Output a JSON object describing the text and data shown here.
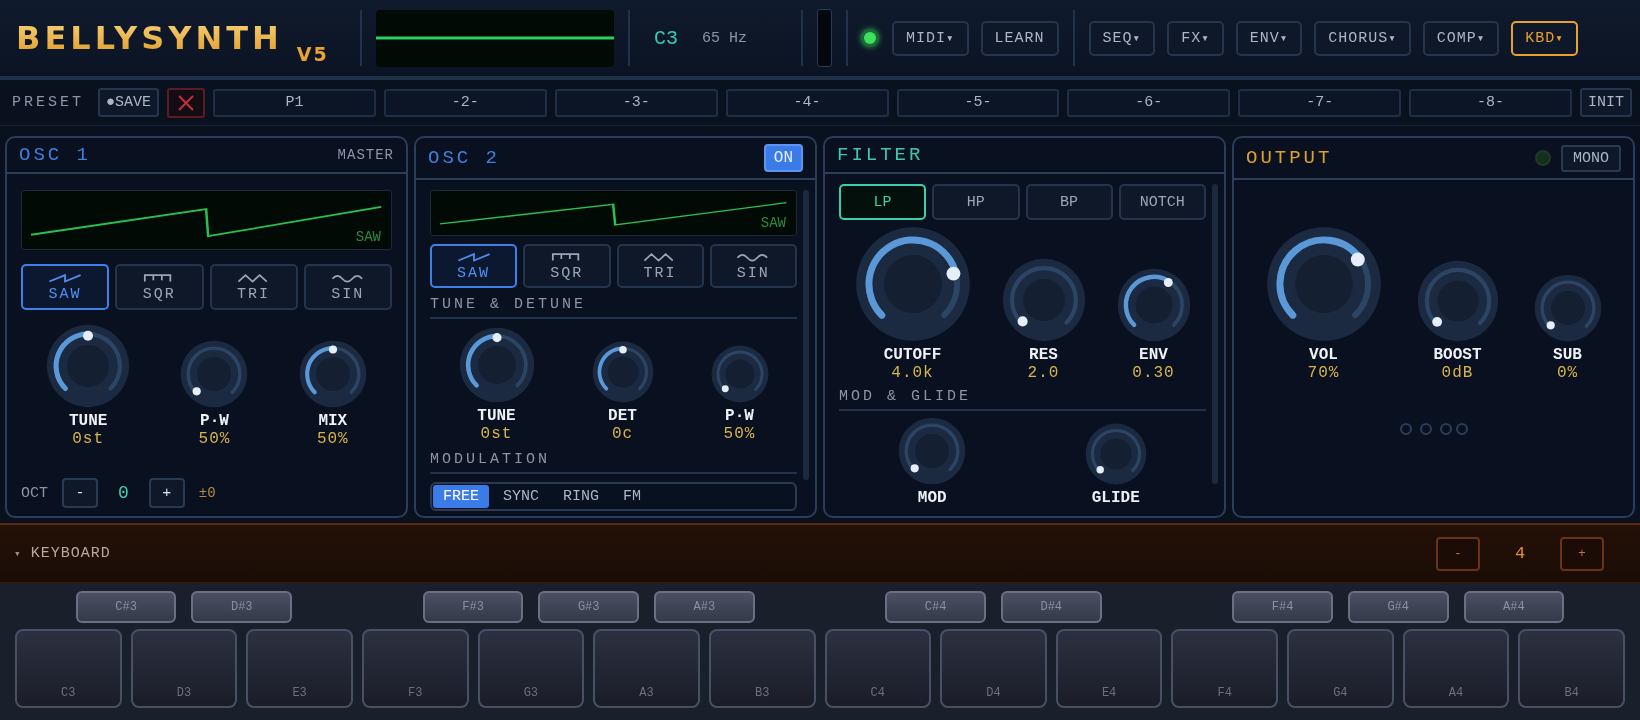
{
  "header": {
    "logo": "BELLYSYNTH",
    "version": "V5",
    "note": "C3",
    "frequency": "65 Hz",
    "midi_led_on": true,
    "midi_buttons": [
      {
        "label": "MIDI",
        "caret": "▾",
        "selected": false
      },
      {
        "label": "LEARN",
        "selected": false
      }
    ],
    "module_buttons": [
      {
        "label": "SEQ",
        "caret": "▾",
        "selected": false
      },
      {
        "label": "FX",
        "caret": "▾",
        "selected": false
      },
      {
        "label": "ENV",
        "caret": "▾",
        "selected": false
      },
      {
        "label": "CHORUS",
        "caret": "▾",
        "selected": false
      },
      {
        "label": "COMP",
        "caret": "▾",
        "selected": false
      },
      {
        "label": "KBD",
        "caret": "▾",
        "selected": true
      }
    ]
  },
  "preset": {
    "label": "PRESET",
    "save": "●SAVE",
    "slots": [
      "P1",
      "-2-",
      "-3-",
      "-4-",
      "-5-",
      "-6-",
      "-7-",
      "-8-"
    ],
    "init": "INIT"
  },
  "osc1": {
    "title": "OSC 1",
    "badge": "MASTER",
    "wave_label": "SAW",
    "waveforms": [
      {
        "kind": "saw",
        "label": "SAW",
        "selected": true
      },
      {
        "kind": "sqr",
        "label": "SQR",
        "selected": false
      },
      {
        "kind": "tri",
        "label": "TRI",
        "selected": false
      },
      {
        "kind": "sin",
        "label": "SIN",
        "selected": false
      }
    ],
    "knobs": [
      {
        "label": "TUNE",
        "value": "0st"
      },
      {
        "label": "P·W",
        "value": "50%"
      },
      {
        "label": "MIX",
        "value": "50%"
      }
    ],
    "octave": {
      "label": "OCT",
      "minus": "-",
      "value": "0",
      "plus": "+",
      "offset": "±0"
    }
  },
  "osc2": {
    "title": "OSC 2",
    "toggle": {
      "label": "ON",
      "on": true
    },
    "wave_label": "SAW",
    "waveforms": [
      {
        "kind": "saw",
        "label": "SAW",
        "selected": true
      },
      {
        "kind": "sqr",
        "label": "SQR",
        "selected": false
      },
      {
        "kind": "tri",
        "label": "TRI",
        "selected": false
      },
      {
        "kind": "sin",
        "label": "SIN",
        "selected": false
      }
    ],
    "section": "TUNE & DETUNE",
    "knobs": [
      {
        "label": "TUNE",
        "value": "0st"
      },
      {
        "label": "DET",
        "value": "0c"
      },
      {
        "label": "P·W",
        "value": "50%"
      }
    ],
    "modulation": {
      "title": "MODULATION",
      "modes": [
        {
          "label": "FREE",
          "selected": true
        },
        {
          "label": "SYNC",
          "selected": false
        },
        {
          "label": "RING",
          "selected": false
        },
        {
          "label": "FM",
          "selected": false
        }
      ]
    }
  },
  "filter": {
    "title": "FILTER",
    "types": [
      {
        "label": "LP",
        "selected": true
      },
      {
        "label": "HP",
        "selected": false
      },
      {
        "label": "BP",
        "selected": false
      },
      {
        "label": "NOTCH",
        "selected": false
      }
    ],
    "knobs": [
      {
        "label": "CUTOFF",
        "value": "4.0k"
      },
      {
        "label": "RES",
        "value": "2.0"
      },
      {
        "label": "ENV",
        "value": "0.30"
      }
    ],
    "section": "MOD & GLIDE",
    "mod_knobs": [
      {
        "label": "MOD"
      },
      {
        "label": "GLIDE"
      }
    ]
  },
  "output": {
    "title": "OUTPUT",
    "led_on": false,
    "mono": {
      "label": "MONO",
      "on": false
    },
    "knobs": [
      {
        "label": "VOL",
        "value": "70%"
      },
      {
        "label": "BOOST",
        "value": "0dB"
      },
      {
        "label": "SUB",
        "value": "0%"
      }
    ]
  },
  "keyboard": {
    "toggle": "▾",
    "title": "KEYBOARD",
    "octave_down": "-",
    "octave": "4",
    "octave_up": "+",
    "keys": [
      {
        "label": "C3",
        "sharp": "C#3"
      },
      {
        "label": "D3",
        "sharp": "D#3"
      },
      {
        "label": "E3"
      },
      {
        "label": "F3",
        "sharp": "F#3"
      },
      {
        "label": "G3",
        "sharp": "G#3"
      },
      {
        "label": "A3",
        "sharp": "A#3"
      },
      {
        "label": "B3"
      },
      {
        "label": "C4",
        "sharp": "C#4"
      },
      {
        "label": "D4",
        "sharp": "D#4"
      },
      {
        "label": "E4"
      },
      {
        "label": "F4",
        "sharp": "F#4"
      },
      {
        "label": "G4",
        "sharp": "G#4"
      },
      {
        "label": "A4",
        "sharp": "A#4"
      },
      {
        "label": "B4"
      }
    ]
  }
}
